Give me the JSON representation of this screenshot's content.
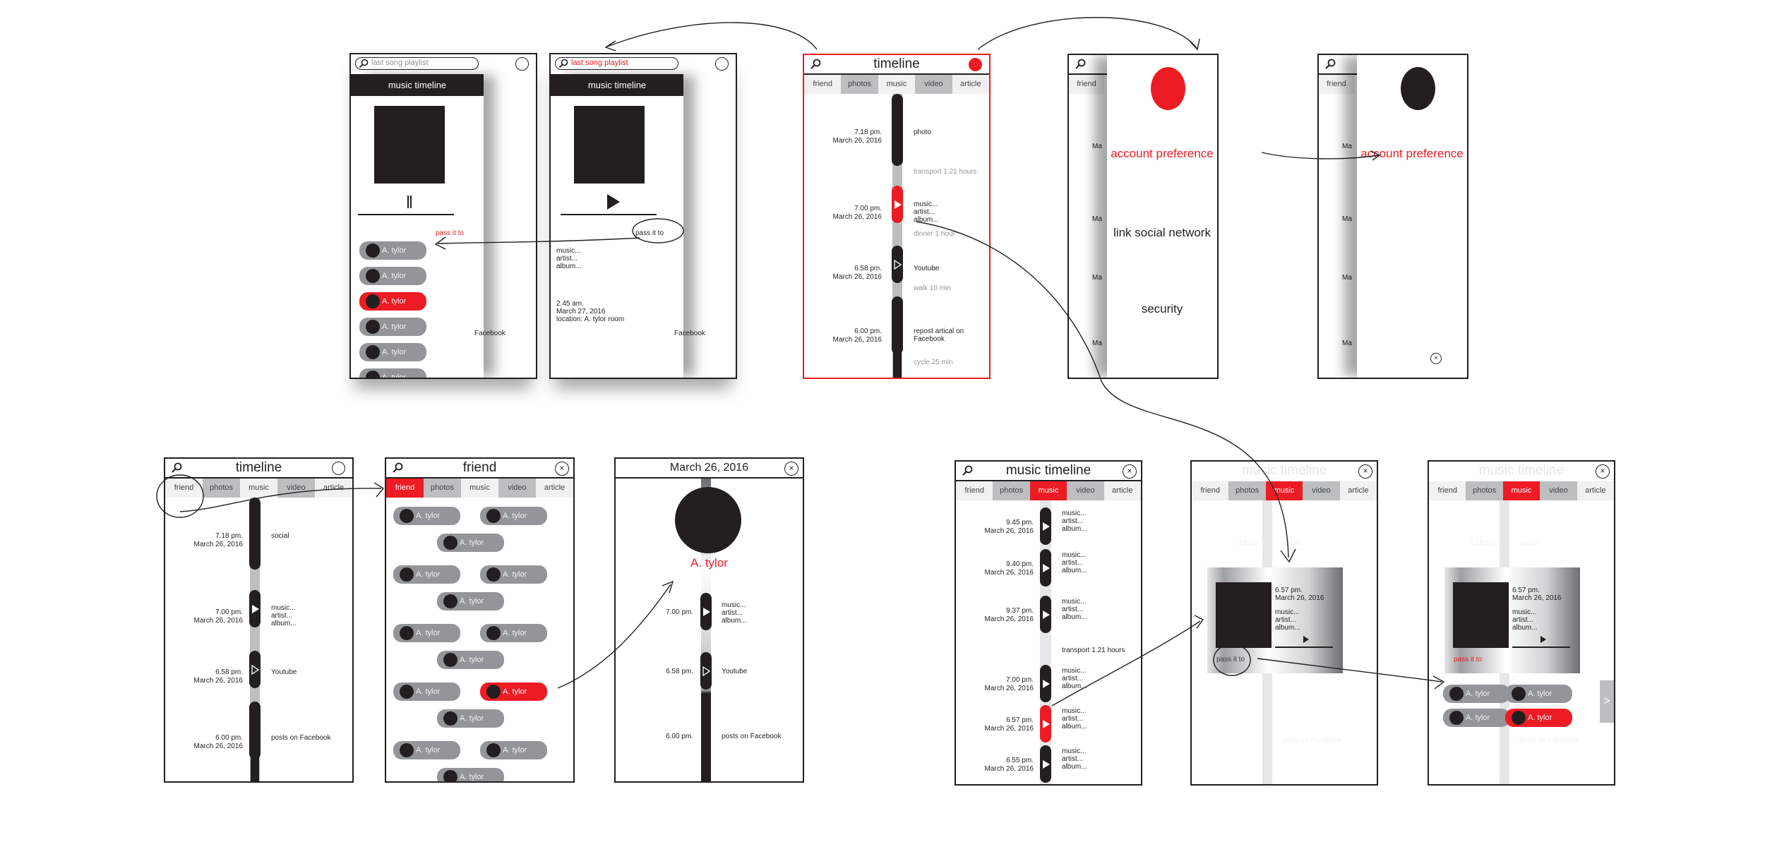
{
  "colors": {
    "accent": "#ed1c24",
    "dark": "#231f20",
    "gray": "#939598",
    "light_gray": "#bcbec0"
  },
  "tabs": [
    "friend",
    "photos",
    "music",
    "video",
    "article"
  ],
  "friend_name": "A. tylor",
  "screen_playlist_pause": {
    "search_value": "last song playlist",
    "drawer_title": "music timeline",
    "control": "pause",
    "pass_label": "pass it to",
    "friends": [
      "A. tylor",
      "A. tylor",
      "A. tylor",
      "A. tylor",
      "A. tylor",
      "A. tylor"
    ],
    "selected_friend_index": 2,
    "behind_text": "Facebook"
  },
  "screen_playlist_play": {
    "search_value": "last song playlist",
    "drawer_title": "music timeline",
    "control": "play",
    "pass_label": "pass it to",
    "track_lines": [
      "music...",
      "artist...",
      "album..."
    ],
    "passed_time": "2.45 am.",
    "passed_date": "March 27, 2016",
    "passed_location": "location: A. tylor room",
    "behind_text": "Facebook"
  },
  "screen_timeline_main": {
    "title": "timeline",
    "entries": [
      {
        "time": "7.18 pm.",
        "date": "March 26, 2016",
        "desc": [
          "photo"
        ],
        "gap": "transport 1.21 hours"
      },
      {
        "time": "7.00 pm.",
        "date": "March 26, 2016",
        "desc": [
          "music...",
          "artist...",
          "album..."
        ],
        "gap": "dinner 1 hour"
      },
      {
        "time": "6.58 pm.",
        "date": "March 26, 2016",
        "desc": [
          "Youtube"
        ],
        "gap": "walk 10 min"
      },
      {
        "time": "6.00 pm.",
        "date": "March 26, 2016",
        "desc": [
          "repost artical on",
          "Facebook"
        ],
        "gap": "cycle 25 min"
      }
    ]
  },
  "screen_settings": {
    "tab_peek": "friend",
    "peek_text": "Ma",
    "items": [
      "account preference",
      "link social network",
      "security"
    ]
  },
  "screen_settings_detail": {
    "tab_peek": "friend",
    "peek_text": "Ma",
    "item": "account preference"
  },
  "screen_timeline_friend_tap": {
    "title": "timeline",
    "entries": [
      {
        "time": "7.18 pm.",
        "date": "March 26, 2016",
        "desc": [
          "social"
        ]
      },
      {
        "time": "7.00 pm.",
        "date": "March 26, 2016",
        "desc": [
          "music...",
          "artist...",
          "album..."
        ]
      },
      {
        "time": "6.58 pm.",
        "date": "March 26, 2016",
        "desc": [
          "Youtube"
        ]
      },
      {
        "time": "6.00 pm.",
        "date": "March 26, 2016",
        "desc": [
          "posts on Facebook"
        ]
      }
    ]
  },
  "screen_friend": {
    "title": "friend",
    "friends_count": 15,
    "selected_friend_index": 10
  },
  "screen_friend_profile": {
    "title": "March 26, 2016",
    "name": "A. tylor",
    "entries": [
      {
        "time": "7.00 pm.",
        "desc": [
          "music...",
          "artist...",
          "album..."
        ]
      },
      {
        "time": "6.58 pm.",
        "desc": [
          "Youtube"
        ]
      },
      {
        "time": "6.00 pm.",
        "desc": [
          "posts on Facebook"
        ]
      }
    ]
  },
  "screen_music_timeline": {
    "title": "music timeline",
    "entries": [
      {
        "time": "9.45 pm.",
        "date": "March 26, 2016",
        "desc": [
          "music...",
          "artist...",
          "album..."
        ]
      },
      {
        "time": "9.40 pm.",
        "date": "March 26, 2016",
        "desc": [
          "music...",
          "artist...",
          "album..."
        ]
      },
      {
        "time": "9.37 pm.",
        "date": "March 26, 2016",
        "desc": [
          "music...",
          "artist...",
          "album..."
        ]
      },
      {
        "time": "7.00 pm.",
        "date": "March 26, 2016",
        "desc": [
          "music...",
          "artist...",
          "album..."
        ]
      },
      {
        "time": "6.57 pm.",
        "date": "March 26, 2016",
        "desc": [
          "music...",
          "artist...",
          "album..."
        ]
      },
      {
        "time": "6.55 pm.",
        "date": "March 26, 2016",
        "desc": [
          "music...",
          "artist...",
          "album..."
        ]
      }
    ],
    "gap": "transport 1.21 hours",
    "selected_index": 4
  },
  "screen_music_card": {
    "title": "music timeline",
    "card_time": "6.57 pm.",
    "card_date": "March 26, 2016",
    "track_lines": [
      "music...",
      "artist...",
      "album..."
    ],
    "pass_label": "pass it to",
    "ghost_time": "7.18 pm.",
    "ghost_desc": "social",
    "ghost_footer": "posts on Facebook"
  },
  "screen_music_pass": {
    "title": "music timeline",
    "card_time": "6.57 pm.",
    "card_date": "March 26, 2016",
    "track_lines": [
      "music...",
      "artist...",
      "album..."
    ],
    "pass_label": "pass it to",
    "friends": [
      "A. tylor",
      "A. tylor",
      "A. tylor",
      "A. tylor"
    ],
    "selected_friend_index": 3,
    "next_label": ">",
    "ghost_time": "7.18 pm.",
    "ghost_desc": "social",
    "ghost_footer": "posts on Facebook"
  }
}
